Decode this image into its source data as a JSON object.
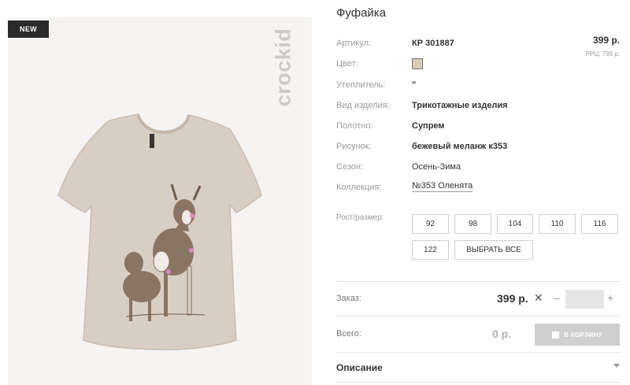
{
  "product": {
    "badge": "NEW",
    "brand": "crockid",
    "title": "Фуфайка",
    "attributes": [
      {
        "label": "Артикул:",
        "value": "КР 301887"
      },
      {
        "label": "Цвет:",
        "value": ""
      },
      {
        "label": "Утеплитель:",
        "value": "\""
      },
      {
        "label": "Вид изделия:",
        "value": "Трикотажные изделия"
      },
      {
        "label": "Полотно:",
        "value": "Супрем"
      },
      {
        "label": "Рисунок:",
        "value": "бежевый меланж к353"
      },
      {
        "label": "Сезон:",
        "value": "Осень-Зима"
      },
      {
        "label": "Коллекция:",
        "value": "№353 Оленята"
      }
    ],
    "color_hex": "#d6cbb4",
    "price": "399 р.",
    "rrp": "РРЦ: 799 р."
  },
  "sizes": {
    "label": "Рост/размер:",
    "options": [
      "92",
      "98",
      "104",
      "110",
      "116",
      "122"
    ],
    "select_all": "ВЫБРАТЬ ВСЕ"
  },
  "order": {
    "label": "Заказ:",
    "price": "399 р.",
    "quantity": ""
  },
  "total": {
    "label": "Всего:",
    "value": "0 р.",
    "cart_button": "В КОРЗИНУ"
  },
  "description": {
    "label": "Описание"
  }
}
